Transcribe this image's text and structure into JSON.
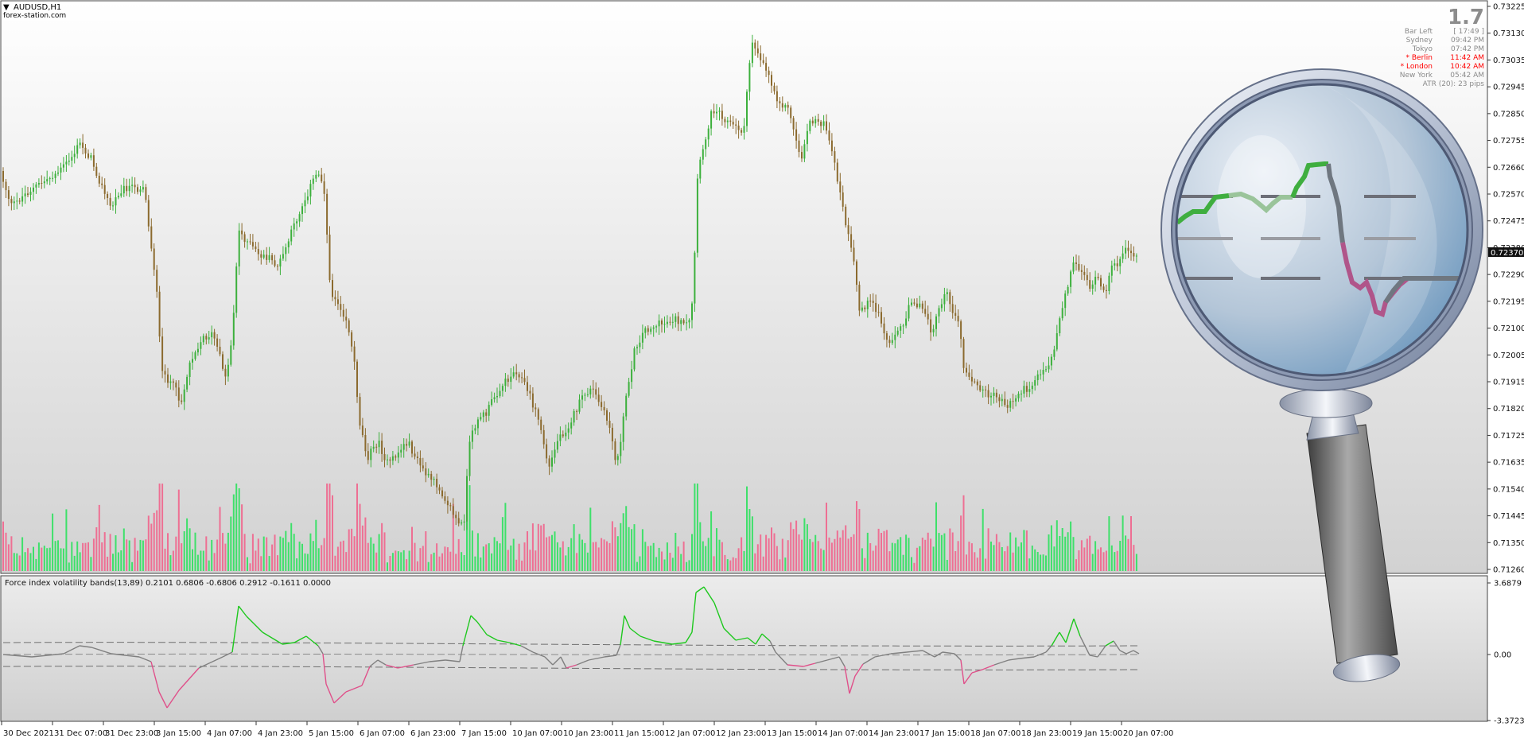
{
  "symbol": {
    "label": "AUDUSD,H1",
    "arrow": "▼",
    "source": "forex-station.com"
  },
  "info_panel": {
    "spread": "1.7",
    "rows": [
      {
        "label": "Bar Left",
        "value": "[ 17:49 ]",
        "color": "#8a8a8a"
      },
      {
        "label": "Sydney",
        "value": "09:42 PM",
        "color": "#8a8a8a"
      },
      {
        "label": "Tokyo",
        "value": "07:42 PM",
        "color": "#8a8a8a"
      },
      {
        "label": "* Berlin",
        "value": "11:42 AM",
        "color": "#ff0000"
      },
      {
        "label": "* London",
        "value": "10:42 AM",
        "color": "#ff0000"
      },
      {
        "label": "New York",
        "value": "05:42 AM",
        "color": "#8a8a8a"
      }
    ],
    "atr": "ATR (20): 23 pips"
  },
  "price_axis": {
    "ticks": [
      "0.73225",
      "0.73130",
      "0.73035",
      "0.72945",
      "0.72850",
      "0.72755",
      "0.72660",
      "0.72570",
      "0.72475",
      "0.72380",
      "0.72290",
      "0.72195",
      "0.72100",
      "0.72005",
      "0.71915",
      "0.71820",
      "0.71725",
      "0.71635",
      "0.71540",
      "0.71445",
      "0.71350",
      "0.71260"
    ],
    "current_price": "0.72370"
  },
  "indicator": {
    "title": "Force index volatility bands(13,89) 0.2101 0.6806 -0.6806 0.2912 -0.1611 0.0000",
    "ticks": [
      "3.6879",
      "0.00",
      "-3.3723"
    ]
  },
  "time_axis": {
    "labels": [
      "30 Dec 2021",
      "31 Dec 07:00",
      "31 Dec 23:00",
      "3 Jan 15:00",
      "4 Jan 07:00",
      "4 Jan 23:00",
      "5 Jan 15:00",
      "6 Jan 07:00",
      "6 Jan 23:00",
      "7 Jan 15:00",
      "10 Jan 07:00",
      "10 Jan 23:00",
      "11 Jan 15:00",
      "12 Jan 07:00",
      "12 Jan 23:00",
      "13 Jan 15:00",
      "14 Jan 07:00",
      "14 Jan 23:00",
      "17 Jan 15:00",
      "18 Jan 07:00",
      "18 Jan 23:00",
      "19 Jan 15:00",
      "20 Jan 07:00"
    ]
  },
  "colors": {
    "bull": "#3cb03c",
    "bear": "#8b6a2e",
    "vol_up": "#3ee06a",
    "vol_down": "#ee6f93",
    "force_up": "#1ec81e",
    "force_down": "#e0508a",
    "force_neutral": "#808080"
  },
  "decoration": {
    "magnifier": "magnifying-glass-graphic"
  }
}
